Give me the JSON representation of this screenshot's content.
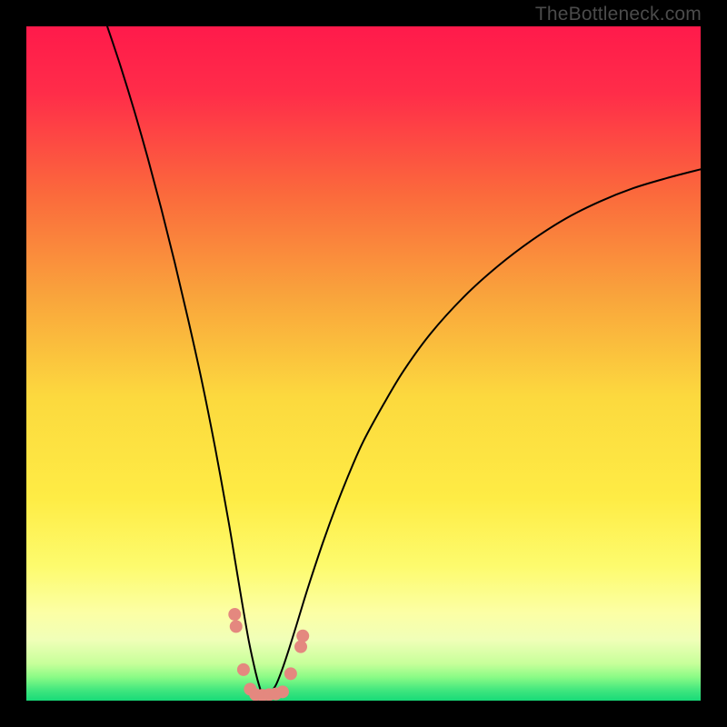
{
  "watermark": "TheBottleneck.com",
  "chart_data": {
    "type": "line",
    "title": "",
    "xlabel": "",
    "ylabel": "",
    "xlim": [
      0,
      100
    ],
    "ylim": [
      0,
      100
    ],
    "background_gradient": {
      "stops": [
        {
          "offset": 0.0,
          "color": "#ff1a4b"
        },
        {
          "offset": 0.1,
          "color": "#ff2d49"
        },
        {
          "offset": 0.25,
          "color": "#fb6a3c"
        },
        {
          "offset": 0.4,
          "color": "#f9a43c"
        },
        {
          "offset": 0.55,
          "color": "#fcd93e"
        },
        {
          "offset": 0.7,
          "color": "#feec45"
        },
        {
          "offset": 0.8,
          "color": "#fdfb6d"
        },
        {
          "offset": 0.87,
          "color": "#fcffa5"
        },
        {
          "offset": 0.91,
          "color": "#f0ffb8"
        },
        {
          "offset": 0.945,
          "color": "#c7ff9a"
        },
        {
          "offset": 0.965,
          "color": "#8bfb86"
        },
        {
          "offset": 0.985,
          "color": "#3fe67e"
        },
        {
          "offset": 1.0,
          "color": "#18db78"
        }
      ]
    },
    "series": [
      {
        "name": "bottleneck-curve",
        "color": "#000000",
        "stroke_width": 2,
        "x": [
          12,
          14,
          16,
          18,
          20,
          22,
          24,
          26,
          28,
          30,
          31,
          32,
          33,
          34,
          34.6,
          35,
          35.5,
          36,
          37,
          38,
          39,
          40,
          41,
          42,
          44,
          46,
          48,
          50,
          53,
          56,
          60,
          65,
          70,
          75,
          80,
          85,
          90,
          95,
          100
        ],
        "y": [
          100,
          94,
          87.5,
          80.5,
          73,
          65,
          56.5,
          47.5,
          37.5,
          26.5,
          20.5,
          14.5,
          8.8,
          4.2,
          2.0,
          1.0,
          0.6,
          1.0,
          2.3,
          4.8,
          7.8,
          11.0,
          14.3,
          17.5,
          23.5,
          29.0,
          34.0,
          38.5,
          44.0,
          49.0,
          54.5,
          60.0,
          64.5,
          68.3,
          71.5,
          74.0,
          76.0,
          77.5,
          78.8
        ]
      }
    ],
    "markers": {
      "name": "highlight-dots",
      "color": "#e4887f",
      "radius": 7,
      "points": [
        {
          "x": 30.9,
          "y": 12.8
        },
        {
          "x": 31.1,
          "y": 11.0
        },
        {
          "x": 32.2,
          "y": 4.6
        },
        {
          "x": 33.2,
          "y": 1.7
        },
        {
          "x": 34.0,
          "y": 0.9
        },
        {
          "x": 35.0,
          "y": 0.8
        },
        {
          "x": 36.0,
          "y": 0.9
        },
        {
          "x": 37.0,
          "y": 1.0
        },
        {
          "x": 38.0,
          "y": 1.3
        },
        {
          "x": 39.2,
          "y": 4.0
        },
        {
          "x": 40.7,
          "y": 8.0
        },
        {
          "x": 41.0,
          "y": 9.6
        }
      ]
    }
  }
}
